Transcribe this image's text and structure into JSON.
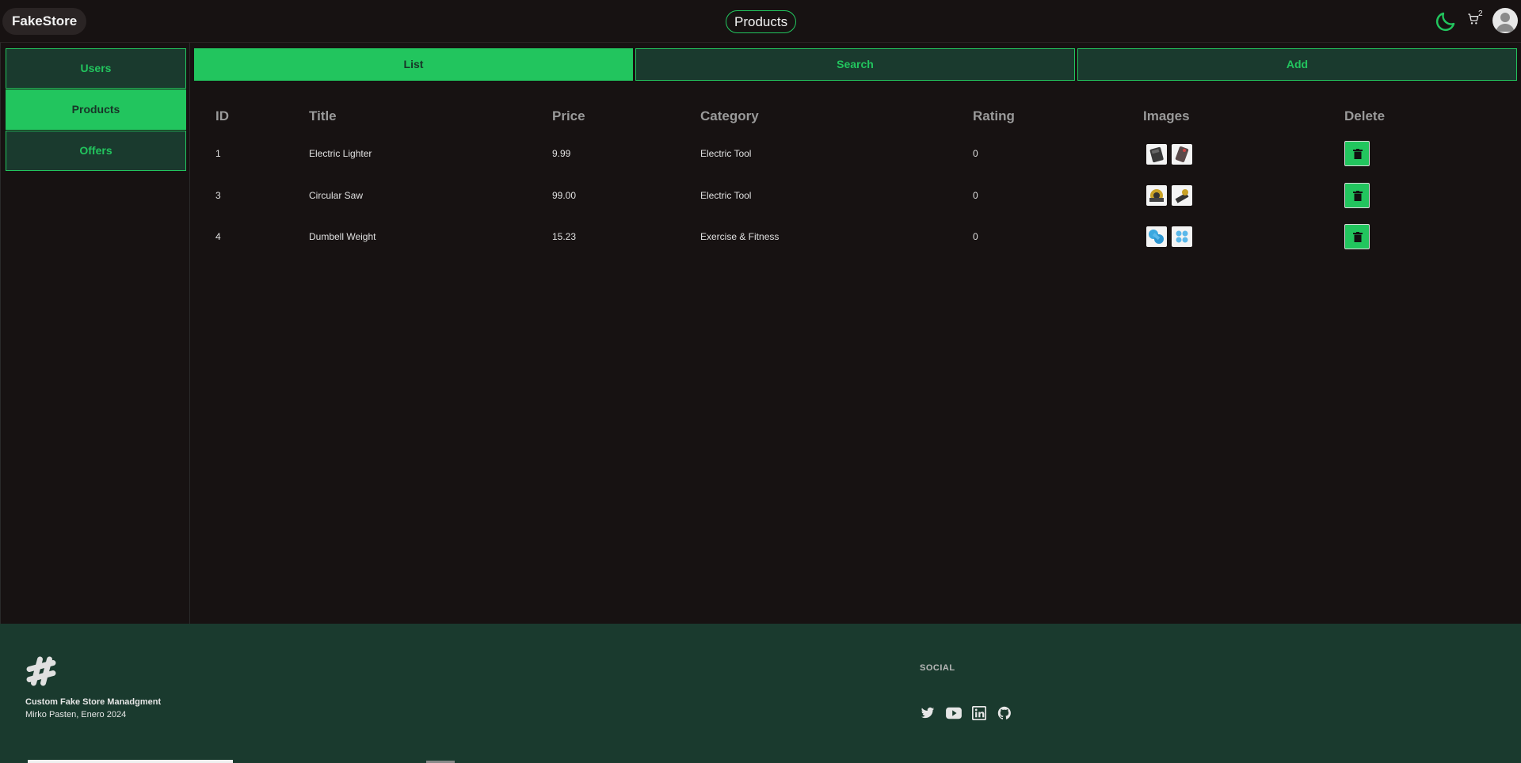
{
  "header": {
    "brand": "FakeStore",
    "page_title": "Products",
    "cart_count": "2"
  },
  "sidebar": {
    "items": [
      {
        "label": "Users"
      },
      {
        "label": "Products"
      },
      {
        "label": "Offers"
      }
    ]
  },
  "tabs": [
    {
      "label": "List"
    },
    {
      "label": "Search"
    },
    {
      "label": "Add"
    }
  ],
  "table": {
    "columns": [
      "ID",
      "Title",
      "Price",
      "Category",
      "Rating",
      "Images",
      "Delete"
    ],
    "rows": [
      {
        "id": "1",
        "title": "Electric Lighter",
        "price": "9.99",
        "category": "Electric Tool",
        "rating": "0"
      },
      {
        "id": "3",
        "title": "Circular Saw",
        "price": "99.00",
        "category": "Electric Tool",
        "rating": "0"
      },
      {
        "id": "4",
        "title": "Dumbell Weight",
        "price": "15.23",
        "category": "Exercise & Fitness",
        "rating": "0"
      }
    ]
  },
  "footer": {
    "title": "Custom Fake Store Manadgment",
    "subtitle": "Mirko Pasten, Enero 2024",
    "social_label": "SOCIAL",
    "social_icons": [
      "twitter-icon",
      "youtube-icon",
      "linkedin-icon",
      "github-icon"
    ]
  },
  "colors": {
    "accent": "#22c55e",
    "background": "#171212",
    "panel": "#1a3a2e"
  }
}
